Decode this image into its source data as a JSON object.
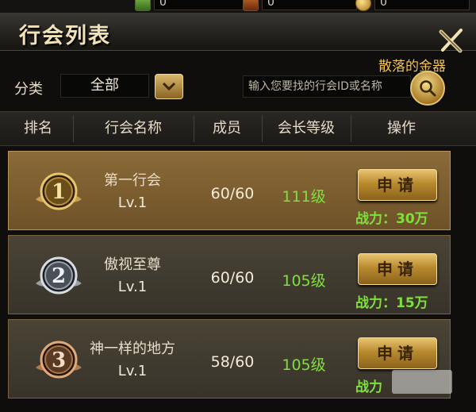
{
  "resources": [
    {
      "icon": "green-resource-icon",
      "value": "0"
    },
    {
      "icon": "red-resource-icon",
      "value": "0"
    },
    {
      "icon": "gold-coin-icon",
      "value": "0"
    }
  ],
  "window": {
    "title": "行会列表",
    "subtitle_link": "散落的金器"
  },
  "filter": {
    "category_label": "分类",
    "category_value": "全部",
    "search_placeholder": "输入您要找的行会ID或名称"
  },
  "table": {
    "headers": [
      "排名",
      "行会名称",
      "成员",
      "会长等级",
      "操作"
    ],
    "rows": [
      {
        "rank": "1",
        "name": "第一行会",
        "lv": "Lv.1",
        "members": "60/60",
        "leader_level": "111级",
        "action": "申请",
        "power_label": "战力：",
        "power_value": "30万"
      },
      {
        "rank": "2",
        "name": "傲视至尊",
        "lv": "Lv.1",
        "members": "60/60",
        "leader_level": "105级",
        "action": "申请",
        "power_label": "战力：",
        "power_value": "15万"
      },
      {
        "rank": "3",
        "name": "神一样的地方",
        "lv": "Lv.1",
        "members": "58/60",
        "leader_level": "105级",
        "action": "申请",
        "power_label": "战力",
        "power_value": ""
      }
    ]
  },
  "colors": {
    "accent_gold": "#f5c64a",
    "level_green": "#7ee03c",
    "rank1_row": "#7a5c2e",
    "row_bg": "#3e392e"
  }
}
